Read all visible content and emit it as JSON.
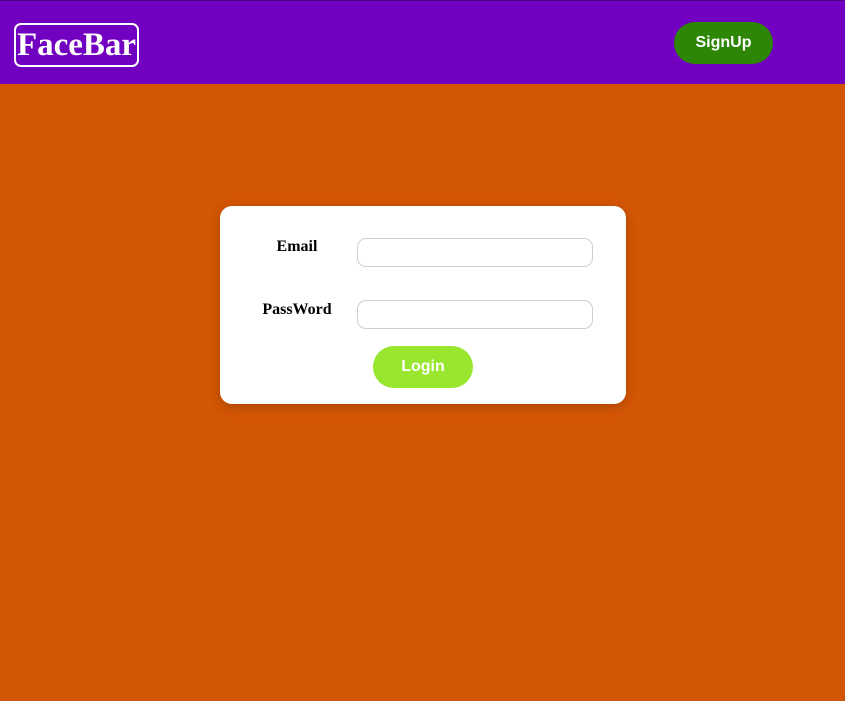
{
  "header": {
    "logo_text": "FaceBar",
    "signup_label": "SignUp"
  },
  "login_form": {
    "email_label": "Email",
    "email_value": "",
    "password_label": "PassWord",
    "password_value": "",
    "login_label": "Login"
  },
  "colors": {
    "page_background": "#d35605",
    "navbar_background": "#7100c0",
    "signup_button": "#2e8607",
    "login_button": "#99e62f",
    "card_background": "#ffffff"
  }
}
